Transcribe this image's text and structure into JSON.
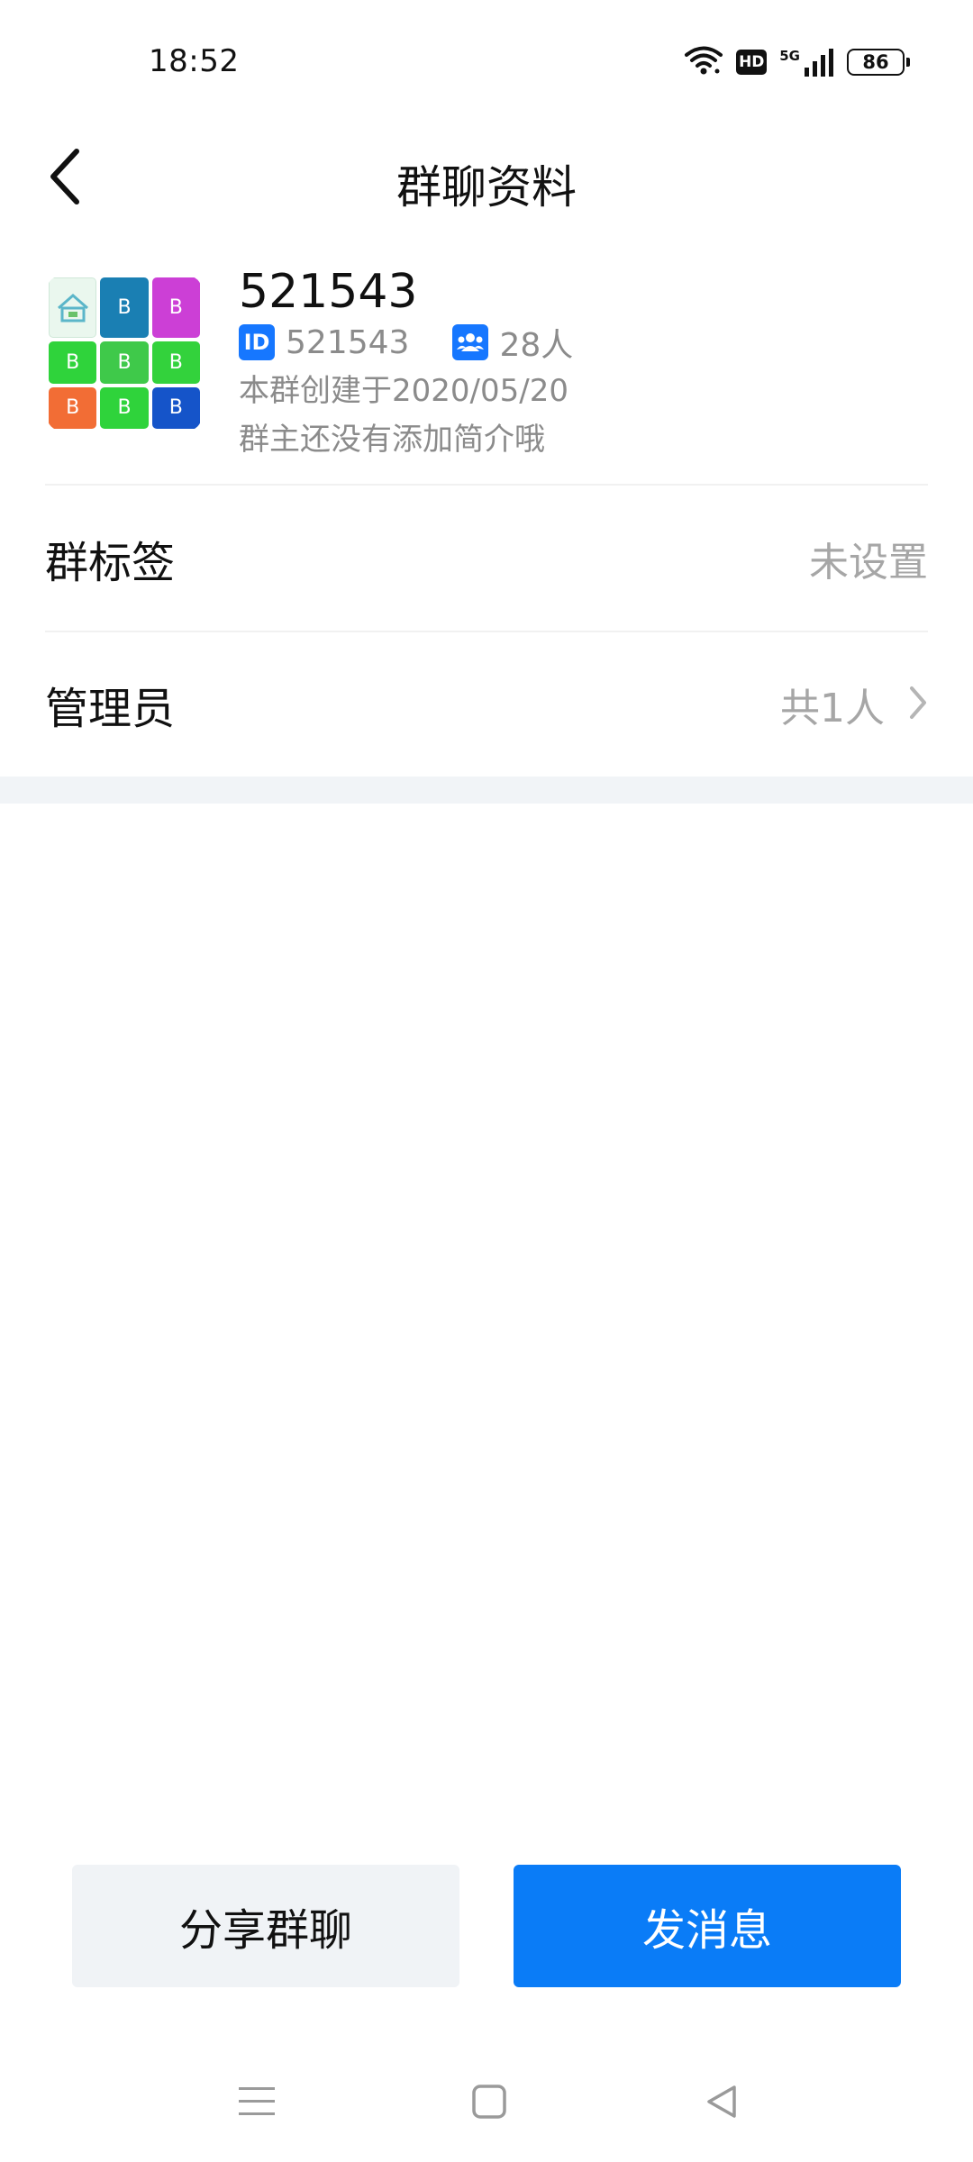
{
  "status_bar": {
    "time": "18:52",
    "hd_label": "HD",
    "network_label": "5G",
    "battery_level": "86"
  },
  "nav": {
    "title": "群聊资料",
    "back_icon": "chevron-left-icon"
  },
  "group": {
    "name": "521543",
    "id_badge": "ID",
    "id_value": "521543",
    "member_count": "28人",
    "created": "本群创建于2020/05/20",
    "intro": "群主还没有添加简介哦",
    "avatar_tiles": [
      {
        "label": "",
        "color": "#eaf7ee"
      },
      {
        "label": "B",
        "color": "#1a7fb3"
      },
      {
        "label": "B",
        "color": "#cc3fd6"
      },
      {
        "label": "B",
        "color": "#2fd33b"
      },
      {
        "label": "B",
        "color": "#3fc94a"
      },
      {
        "label": "B",
        "color": "#33d23c"
      },
      {
        "label": "B",
        "color": "#f26d35"
      },
      {
        "label": "B",
        "color": "#2fd33b"
      },
      {
        "label": "B",
        "color": "#1554c9"
      }
    ]
  },
  "rows": {
    "tag_label": "群标签",
    "tag_value": "未设置",
    "admin_label": "管理员",
    "admin_value": "共1人"
  },
  "buttons": {
    "share": "分享群聊",
    "send": "发消息"
  },
  "colors": {
    "accent": "#0a7cf7",
    "badge_blue": "#1677ff",
    "secondary_text": "#8b8b8b",
    "muted_value": "#a6a6a6",
    "share_bg": "#f0f3f6"
  }
}
